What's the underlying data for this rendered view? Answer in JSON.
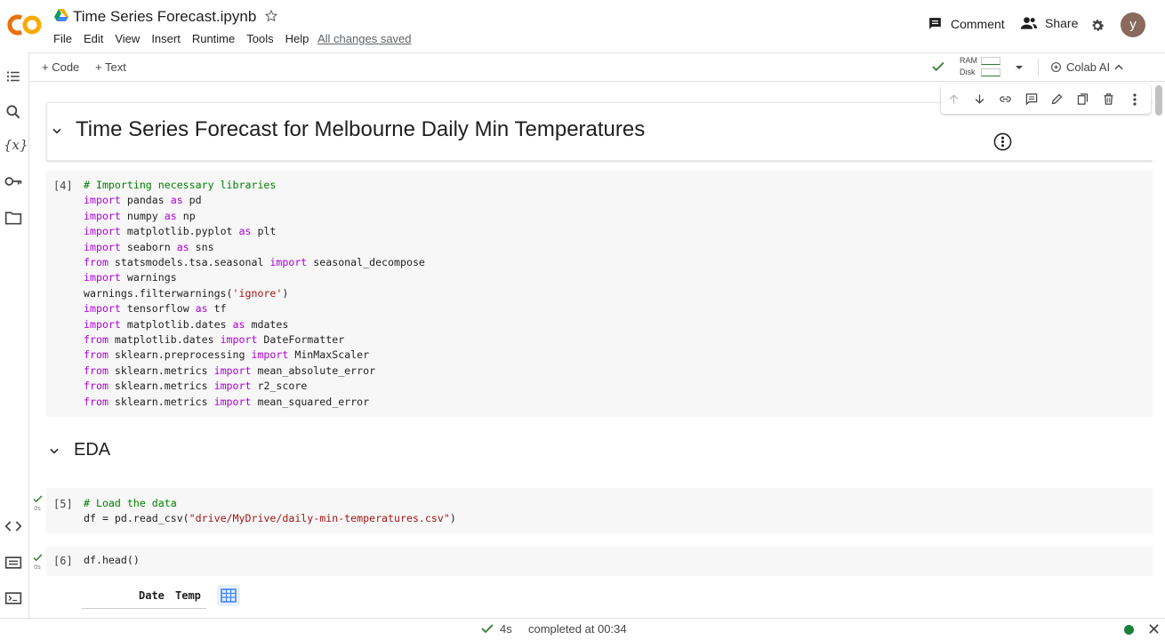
{
  "header": {
    "logo_text": "CO",
    "title": "Time Series Forecast.ipynb",
    "menu": [
      "File",
      "Edit",
      "View",
      "Insert",
      "Runtime",
      "Tools",
      "Help"
    ],
    "save_status": "All changes saved",
    "comment_label": "Comment",
    "share_label": "Share",
    "avatar_letter": "y"
  },
  "toolbar": {
    "add_code": "+ Code",
    "add_text": "+ Text",
    "ram_label": "RAM",
    "disk_label": "Disk",
    "colab_ai_label": "Colab AI"
  },
  "cells": {
    "heading": "Time Series Forecast for Melbourne Daily Min Temperatures",
    "cell4": {
      "exec": "[4]",
      "lines": [
        [
          {
            "t": "# Importing necessary libraries",
            "c": "cm"
          }
        ],
        [
          {
            "t": "import",
            "c": "kw"
          },
          {
            "t": " pandas "
          },
          {
            "t": "as",
            "c": "kw"
          },
          {
            "t": " pd"
          }
        ],
        [
          {
            "t": "import",
            "c": "kw"
          },
          {
            "t": " numpy "
          },
          {
            "t": "as",
            "c": "kw"
          },
          {
            "t": " np"
          }
        ],
        [
          {
            "t": "import",
            "c": "kw"
          },
          {
            "t": " matplotlib.pyplot "
          },
          {
            "t": "as",
            "c": "kw"
          },
          {
            "t": " plt"
          }
        ],
        [
          {
            "t": "import",
            "c": "kw"
          },
          {
            "t": " seaborn "
          },
          {
            "t": "as",
            "c": "kw"
          },
          {
            "t": " sns"
          }
        ],
        [
          {
            "t": "from",
            "c": "kw"
          },
          {
            "t": " statsmodels.tsa.seasonal "
          },
          {
            "t": "import",
            "c": "kw"
          },
          {
            "t": " seasonal_decompose"
          }
        ],
        [
          {
            "t": "import",
            "c": "kw"
          },
          {
            "t": " warnings"
          }
        ],
        [
          {
            "t": "warnings.filterwarnings("
          },
          {
            "t": "'ignore'",
            "c": "st"
          },
          {
            "t": ")"
          }
        ],
        [
          {
            "t": "import",
            "c": "kw"
          },
          {
            "t": " tensorflow "
          },
          {
            "t": "as",
            "c": "kw"
          },
          {
            "t": " tf"
          }
        ],
        [
          {
            "t": "import",
            "c": "kw"
          },
          {
            "t": " matplotlib.dates "
          },
          {
            "t": "as",
            "c": "kw"
          },
          {
            "t": " mdates"
          }
        ],
        [
          {
            "t": "from",
            "c": "kw"
          },
          {
            "t": " matplotlib.dates "
          },
          {
            "t": "import",
            "c": "kw"
          },
          {
            "t": " DateFormatter"
          }
        ],
        [
          {
            "t": "from",
            "c": "kw"
          },
          {
            "t": " sklearn.preprocessing "
          },
          {
            "t": "import",
            "c": "kw"
          },
          {
            "t": " MinMaxScaler"
          }
        ],
        [
          {
            "t": "from",
            "c": "kw"
          },
          {
            "t": " sklearn.metrics "
          },
          {
            "t": "import",
            "c": "kw"
          },
          {
            "t": " mean_absolute_error"
          }
        ],
        [
          {
            "t": "from",
            "c": "kw"
          },
          {
            "t": " sklearn.metrics "
          },
          {
            "t": "import",
            "c": "kw"
          },
          {
            "t": " r2_score"
          }
        ],
        [
          {
            "t": "from",
            "c": "kw"
          },
          {
            "t": " sklearn.metrics "
          },
          {
            "t": "import",
            "c": "kw"
          },
          {
            "t": " mean_squared_error"
          }
        ]
      ]
    },
    "eda_heading": "EDA",
    "cell5": {
      "exec": "[5]",
      "run_time": "0s",
      "lines": [
        [
          {
            "t": "# Load the data",
            "c": "cm"
          }
        ],
        [
          {
            "t": "df = pd.read_csv("
          },
          {
            "t": "\"drive/MyDrive/daily-min-temperatures.csv\"",
            "c": "st"
          },
          {
            "t": ")"
          }
        ]
      ]
    },
    "cell6": {
      "exec": "[6]",
      "run_time": "0s",
      "lines": [
        [
          {
            "t": "df.head()"
          }
        ]
      ]
    },
    "output": {
      "columns": [
        "Date",
        "Temp"
      ]
    }
  },
  "status": {
    "duration": "4s",
    "completed": "completed at 00:34"
  },
  "colors": {
    "keyword": "#af00db",
    "comment": "#008000",
    "string": "#a31515",
    "ok_green": "#2e7d32",
    "logo_orange": "#f9ab00"
  }
}
